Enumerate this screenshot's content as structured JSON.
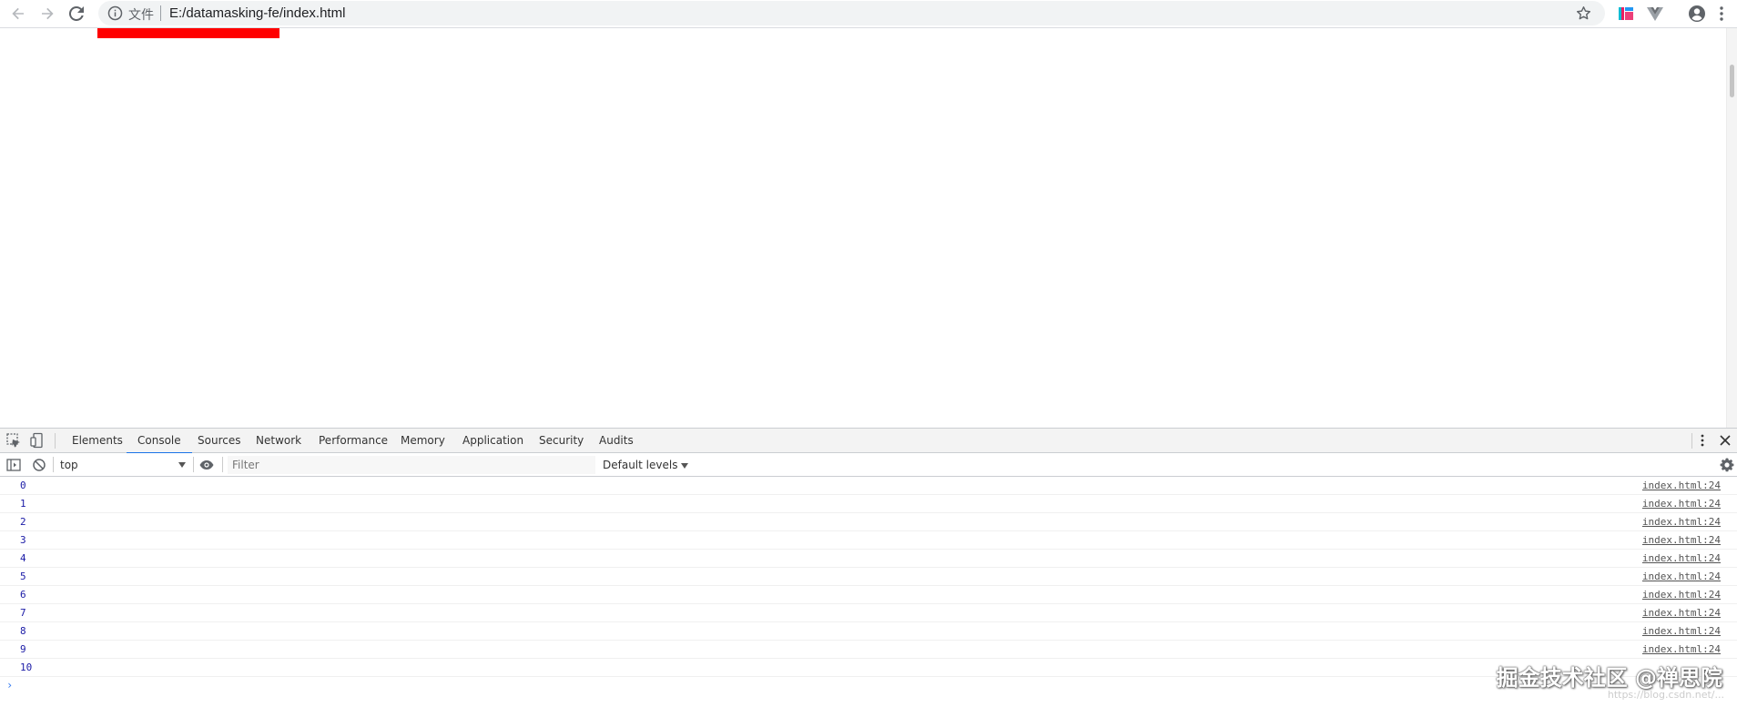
{
  "browser": {
    "scheme_label": "文件",
    "url": "E:/datamasking-fe/index.html"
  },
  "devtools": {
    "tabs": [
      {
        "label": "Elements"
      },
      {
        "label": "Console",
        "active": true
      },
      {
        "label": "Sources"
      },
      {
        "label": "Network"
      },
      {
        "label": "Performance"
      },
      {
        "label": "Memory"
      },
      {
        "label": "Application"
      },
      {
        "label": "Security"
      },
      {
        "label": "Audits"
      }
    ],
    "console": {
      "context": "top",
      "filter_placeholder": "Filter",
      "levels_label": "Default levels",
      "logs": [
        {
          "message": "0",
          "source": "index.html:24"
        },
        {
          "message": "1",
          "source": "index.html:24"
        },
        {
          "message": "2",
          "source": "index.html:24"
        },
        {
          "message": "3",
          "source": "index.html:24"
        },
        {
          "message": "4",
          "source": "index.html:24"
        },
        {
          "message": "5",
          "source": "index.html:24"
        },
        {
          "message": "6",
          "source": "index.html:24"
        },
        {
          "message": "7",
          "source": "index.html:24"
        },
        {
          "message": "8",
          "source": "index.html:24"
        },
        {
          "message": "9",
          "source": "index.html:24"
        },
        {
          "message": "10",
          "source": ""
        }
      ],
      "prompt": "›"
    }
  },
  "watermark": {
    "text": "掘金技术社区 @禅思院",
    "sub": "https://blog.csdn.net/..."
  },
  "colors": {
    "accent": "#1a73e8",
    "log_value": "#1a1aa6",
    "red_block": "#ff0000"
  }
}
